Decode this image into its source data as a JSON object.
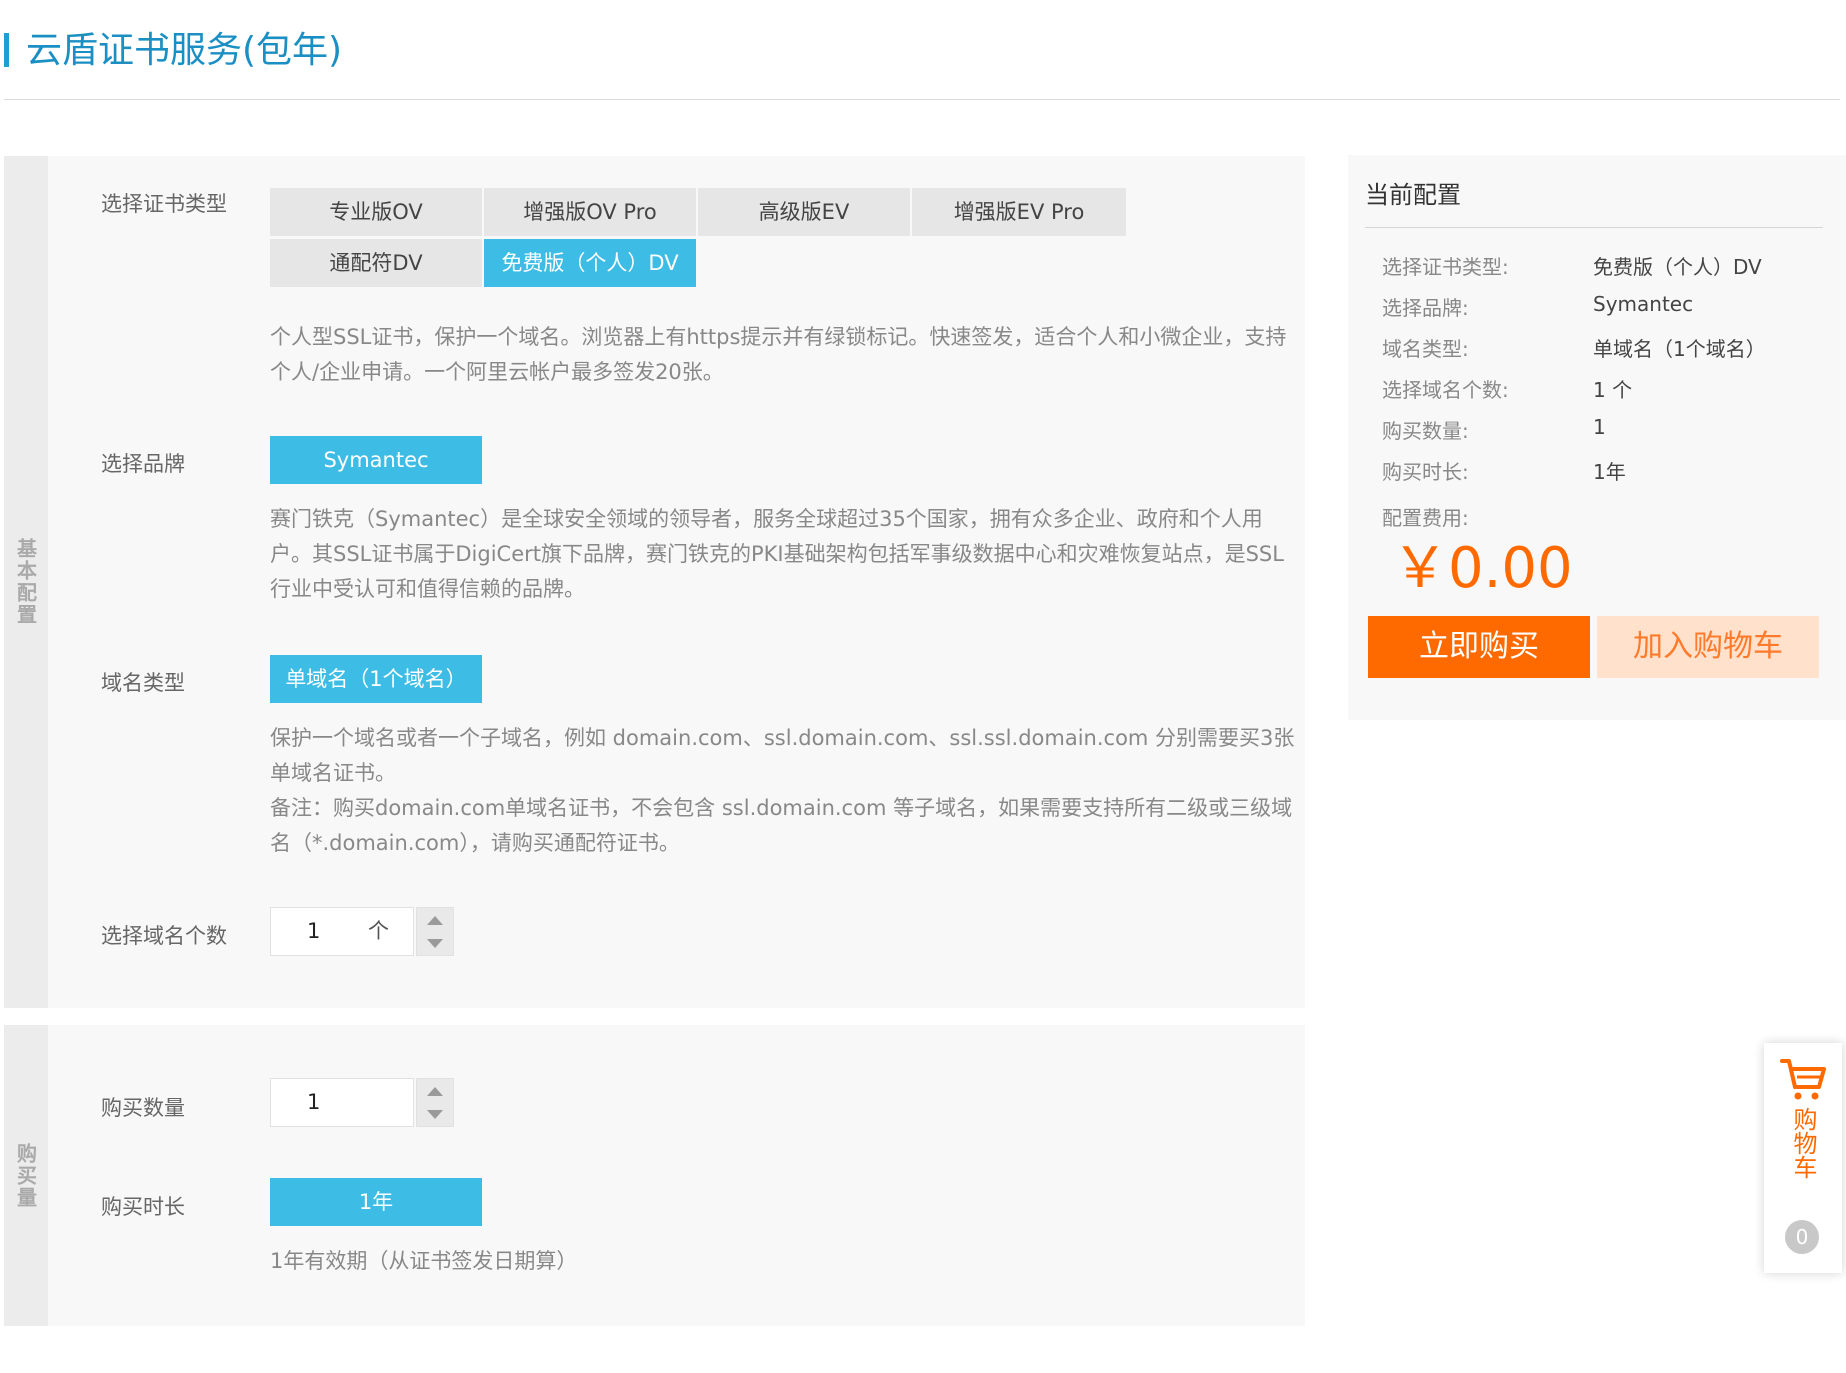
{
  "header": {
    "title": "云盾证书服务(包年)"
  },
  "config": {
    "side_label": "基本配置",
    "cert_type": {
      "label": "选择证书类型",
      "options": [
        "专业版OV",
        "增强版OV Pro",
        "高级版EV",
        "增强版EV Pro",
        "通配符DV",
        "免费版（个人）DV"
      ],
      "selected": "免费版（个人）DV",
      "desc": "个人型SSL证书，保护一个域名。浏览器上有https提示并有绿锁标记。快速签发，适合个人和小微企业，支持个人/企业申请。一个阿里云帐户最多签发20张。"
    },
    "brand": {
      "label": "选择品牌",
      "option": "Symantec",
      "desc": "赛门铁克（Symantec）是全球安全领域的领导者，服务全球超过35个国家，拥有众多企业、政府和个人用户。其SSL证书属于DigiCert旗下品牌，赛门铁克的PKI基础架构包括军事级数据中心和灾难恢复站点，是SSL行业中受认可和值得信赖的品牌。"
    },
    "domain_type": {
      "label": "域名类型",
      "option": "单域名（1个域名）",
      "desc1": "保护一个域名或者一个子域名，例如 domain.com、ssl.domain.com、ssl.ssl.domain.com 分别需要买3张单域名证书。",
      "desc2": "备注：购买domain.com单域名证书，不会包含 ssl.domain.com 等子域名，如果需要支持所有二级或三级域名（*.domain.com），请购买通配符证书。"
    },
    "domain_count": {
      "label": "选择域名个数",
      "value": "1",
      "unit": "个"
    }
  },
  "purchase": {
    "side_label": "购买量",
    "quantity": {
      "label": "购买数量",
      "value": "1"
    },
    "duration": {
      "label": "购买时长",
      "option": "1年",
      "desc": "1年有效期（从证书签发日期算）"
    }
  },
  "summary": {
    "title": "当前配置",
    "rows": [
      {
        "key": "选择证书类型:",
        "value": "免费版（个人）DV"
      },
      {
        "key": "选择品牌:",
        "value": "Symantec"
      },
      {
        "key": "域名类型:",
        "value": "单域名（1个域名）"
      },
      {
        "key": "选择域名个数:",
        "value": "1 个"
      },
      {
        "key": "购买数量:",
        "value": "1"
      },
      {
        "key": "购买时长:",
        "value": "1年"
      }
    ],
    "fee_label": "配置费用:",
    "price": "￥0.00",
    "buy_now": "立即购买",
    "add_cart": "加入购物车"
  },
  "float_cart": {
    "label": "购物车",
    "count": "0",
    "icon": "shopping-cart-icon"
  },
  "colors": {
    "accent": "#3dbde6",
    "orange": "#ff6a00",
    "title_blue": "#1a8fc4"
  }
}
